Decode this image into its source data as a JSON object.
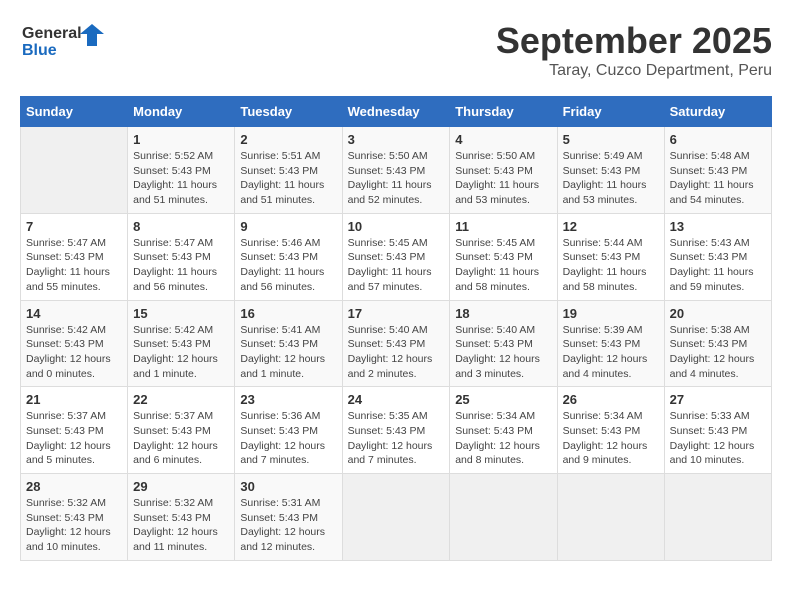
{
  "logo": {
    "general": "General",
    "blue": "Blue"
  },
  "header": {
    "month_title": "September 2025",
    "subtitle": "Taray, Cuzco Department, Peru"
  },
  "days_of_week": [
    "Sunday",
    "Monday",
    "Tuesday",
    "Wednesday",
    "Thursday",
    "Friday",
    "Saturday"
  ],
  "weeks": [
    [
      {
        "day": "",
        "info": ""
      },
      {
        "day": "1",
        "info": "Sunrise: 5:52 AM\nSunset: 5:43 PM\nDaylight: 11 hours\nand 51 minutes."
      },
      {
        "day": "2",
        "info": "Sunrise: 5:51 AM\nSunset: 5:43 PM\nDaylight: 11 hours\nand 51 minutes."
      },
      {
        "day": "3",
        "info": "Sunrise: 5:50 AM\nSunset: 5:43 PM\nDaylight: 11 hours\nand 52 minutes."
      },
      {
        "day": "4",
        "info": "Sunrise: 5:50 AM\nSunset: 5:43 PM\nDaylight: 11 hours\nand 53 minutes."
      },
      {
        "day": "5",
        "info": "Sunrise: 5:49 AM\nSunset: 5:43 PM\nDaylight: 11 hours\nand 53 minutes."
      },
      {
        "day": "6",
        "info": "Sunrise: 5:48 AM\nSunset: 5:43 PM\nDaylight: 11 hours\nand 54 minutes."
      }
    ],
    [
      {
        "day": "7",
        "info": "Sunrise: 5:47 AM\nSunset: 5:43 PM\nDaylight: 11 hours\nand 55 minutes."
      },
      {
        "day": "8",
        "info": "Sunrise: 5:47 AM\nSunset: 5:43 PM\nDaylight: 11 hours\nand 56 minutes."
      },
      {
        "day": "9",
        "info": "Sunrise: 5:46 AM\nSunset: 5:43 PM\nDaylight: 11 hours\nand 56 minutes."
      },
      {
        "day": "10",
        "info": "Sunrise: 5:45 AM\nSunset: 5:43 PM\nDaylight: 11 hours\nand 57 minutes."
      },
      {
        "day": "11",
        "info": "Sunrise: 5:45 AM\nSunset: 5:43 PM\nDaylight: 11 hours\nand 58 minutes."
      },
      {
        "day": "12",
        "info": "Sunrise: 5:44 AM\nSunset: 5:43 PM\nDaylight: 11 hours\nand 58 minutes."
      },
      {
        "day": "13",
        "info": "Sunrise: 5:43 AM\nSunset: 5:43 PM\nDaylight: 11 hours\nand 59 minutes."
      }
    ],
    [
      {
        "day": "14",
        "info": "Sunrise: 5:42 AM\nSunset: 5:43 PM\nDaylight: 12 hours\nand 0 minutes."
      },
      {
        "day": "15",
        "info": "Sunrise: 5:42 AM\nSunset: 5:43 PM\nDaylight: 12 hours\nand 1 minute."
      },
      {
        "day": "16",
        "info": "Sunrise: 5:41 AM\nSunset: 5:43 PM\nDaylight: 12 hours\nand 1 minute."
      },
      {
        "day": "17",
        "info": "Sunrise: 5:40 AM\nSunset: 5:43 PM\nDaylight: 12 hours\nand 2 minutes."
      },
      {
        "day": "18",
        "info": "Sunrise: 5:40 AM\nSunset: 5:43 PM\nDaylight: 12 hours\nand 3 minutes."
      },
      {
        "day": "19",
        "info": "Sunrise: 5:39 AM\nSunset: 5:43 PM\nDaylight: 12 hours\nand 4 minutes."
      },
      {
        "day": "20",
        "info": "Sunrise: 5:38 AM\nSunset: 5:43 PM\nDaylight: 12 hours\nand 4 minutes."
      }
    ],
    [
      {
        "day": "21",
        "info": "Sunrise: 5:37 AM\nSunset: 5:43 PM\nDaylight: 12 hours\nand 5 minutes."
      },
      {
        "day": "22",
        "info": "Sunrise: 5:37 AM\nSunset: 5:43 PM\nDaylight: 12 hours\nand 6 minutes."
      },
      {
        "day": "23",
        "info": "Sunrise: 5:36 AM\nSunset: 5:43 PM\nDaylight: 12 hours\nand 7 minutes."
      },
      {
        "day": "24",
        "info": "Sunrise: 5:35 AM\nSunset: 5:43 PM\nDaylight: 12 hours\nand 7 minutes."
      },
      {
        "day": "25",
        "info": "Sunrise: 5:34 AM\nSunset: 5:43 PM\nDaylight: 12 hours\nand 8 minutes."
      },
      {
        "day": "26",
        "info": "Sunrise: 5:34 AM\nSunset: 5:43 PM\nDaylight: 12 hours\nand 9 minutes."
      },
      {
        "day": "27",
        "info": "Sunrise: 5:33 AM\nSunset: 5:43 PM\nDaylight: 12 hours\nand 10 minutes."
      }
    ],
    [
      {
        "day": "28",
        "info": "Sunrise: 5:32 AM\nSunset: 5:43 PM\nDaylight: 12 hours\nand 10 minutes."
      },
      {
        "day": "29",
        "info": "Sunrise: 5:32 AM\nSunset: 5:43 PM\nDaylight: 12 hours\nand 11 minutes."
      },
      {
        "day": "30",
        "info": "Sunrise: 5:31 AM\nSunset: 5:43 PM\nDaylight: 12 hours\nand 12 minutes."
      },
      {
        "day": "",
        "info": ""
      },
      {
        "day": "",
        "info": ""
      },
      {
        "day": "",
        "info": ""
      },
      {
        "day": "",
        "info": ""
      }
    ]
  ]
}
